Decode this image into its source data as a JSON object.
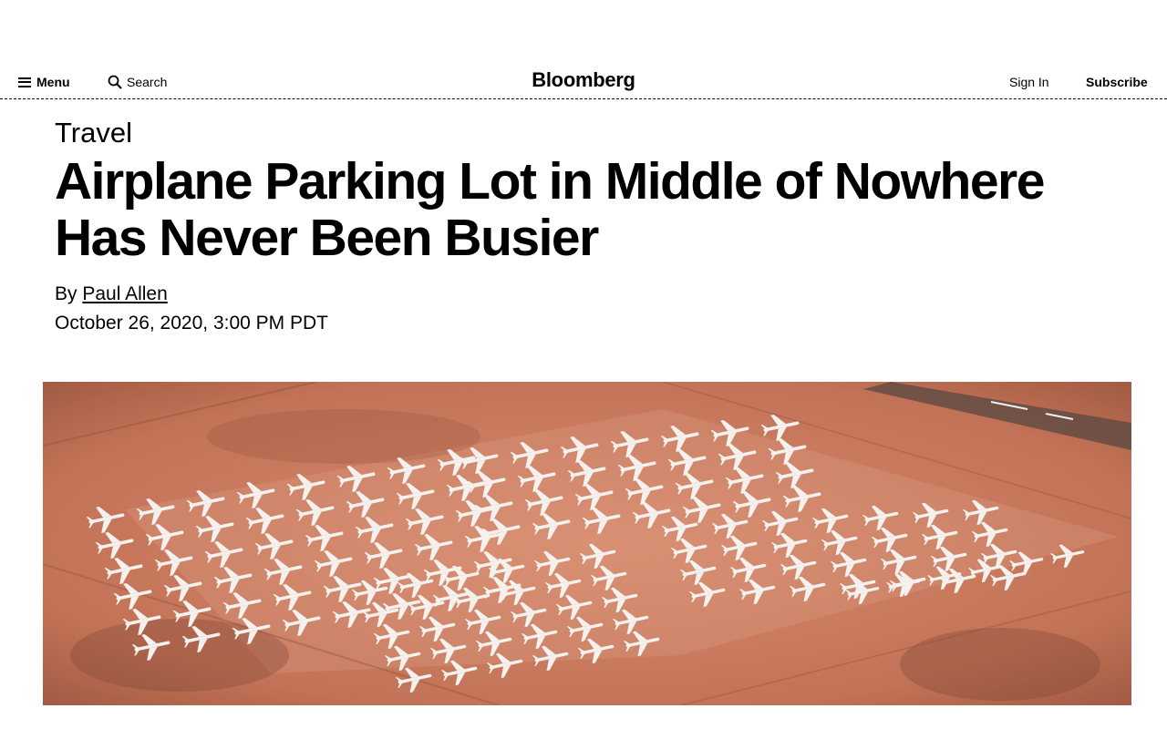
{
  "header": {
    "menu_label": "Menu",
    "search_label": "Search",
    "logo": "Bloomberg",
    "signin_label": "Sign In",
    "subscribe_label": "Subscribe"
  },
  "article": {
    "category": "Travel",
    "headline": "Airplane Parking Lot in Middle of Nowhere Has Never Been Busier",
    "byline_prefix": "By",
    "author": "Paul Allen",
    "date": "October 26, 2020, 3:00 PM PDT"
  },
  "colors": {
    "desert": "#c97a5e",
    "desert_dark": "#8c4a36",
    "plane": "#f4f1ee"
  },
  "icons": {
    "menu": "hamburger-icon",
    "search": "magnifier-icon"
  }
}
